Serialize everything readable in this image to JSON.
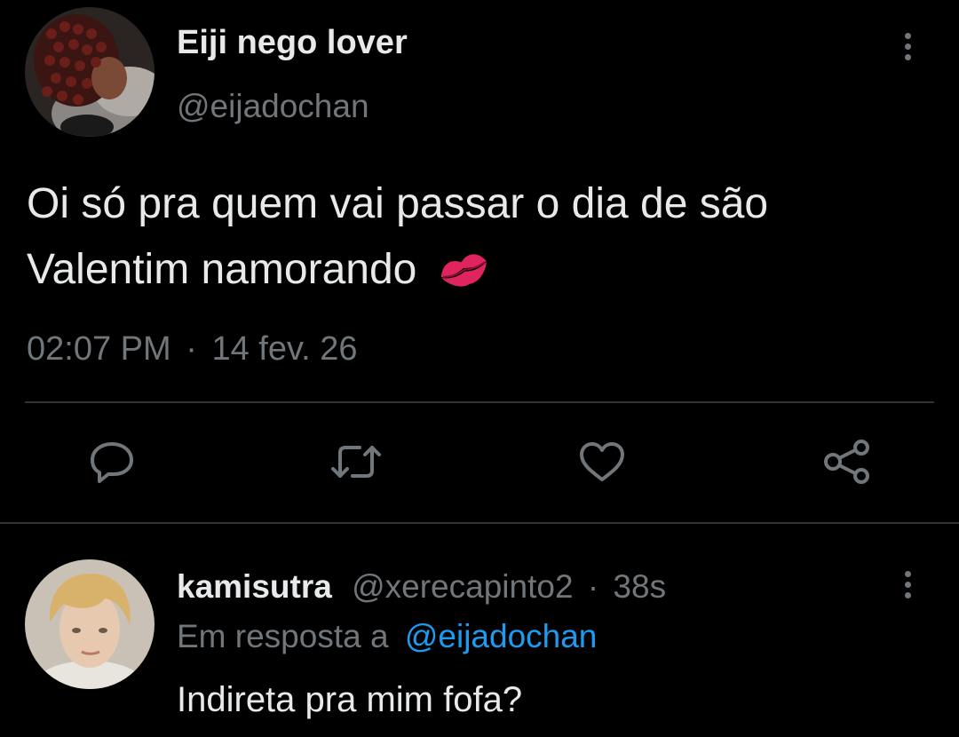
{
  "tweet": {
    "display_name": "Eiji nego lover",
    "handle": "@eijadochan",
    "text_line1": "Oi só pra quem vai passar o dia de são",
    "text_line2": "Valentim namorando",
    "emoji": "💋",
    "time": "02:07 PM",
    "separator": "·",
    "date": "14 fev. 26",
    "avatar_icon": "avatar-photo",
    "more_icon": "more-vertical-icon"
  },
  "actions": [
    {
      "name": "reply",
      "icon": "reply-icon"
    },
    {
      "name": "retweet",
      "icon": "retweet-icon"
    },
    {
      "name": "like",
      "icon": "heart-icon"
    },
    {
      "name": "share",
      "icon": "share-icon"
    }
  ],
  "reply": {
    "display_name": "kamisutra",
    "handle": "@xerecapinto2",
    "separator": "·",
    "age": "38s",
    "replying_prefix": "Em resposta a",
    "replying_to": "@eijadochan",
    "text": "Indireta pra mim fofa?"
  },
  "colors": {
    "background": "#000000",
    "primary_text": "#e7e9ea",
    "secondary_text": "#71767b",
    "accent": "#1d9bf0",
    "divider": "#2f3336",
    "emoji_lips": "#e0245e"
  }
}
